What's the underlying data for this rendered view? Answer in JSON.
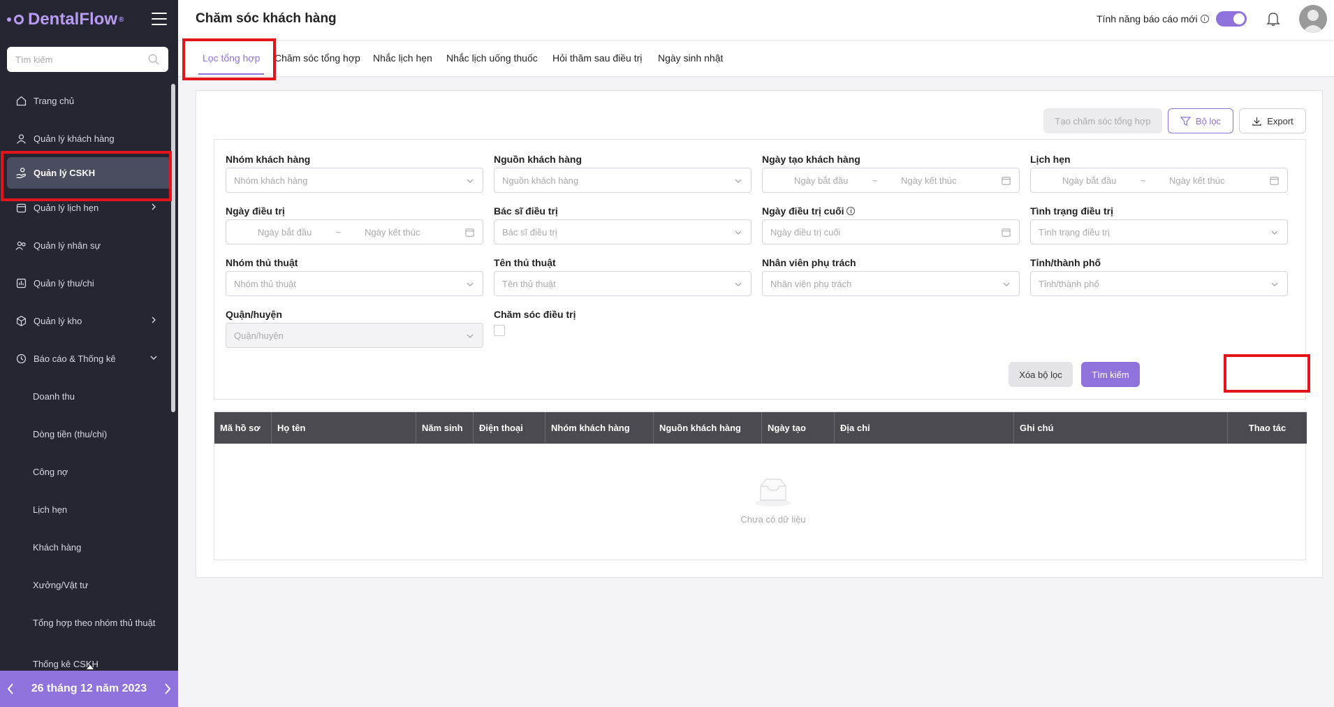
{
  "app": {
    "logo": "DentalFlow",
    "logo_mark": "®"
  },
  "sidebar": {
    "search_placeholder": "Tìm kiếm",
    "items": [
      {
        "label": "Trang chủ",
        "icon": "home-icon"
      },
      {
        "label": "Quản lý khách hàng",
        "icon": "user-icon"
      },
      {
        "label": "Quản lý CSKH",
        "icon": "care-icon",
        "active": true
      },
      {
        "label": "Quản lý lịch hẹn",
        "icon": "calendar-icon"
      },
      {
        "label": "Quản lý nhân sự",
        "icon": "users-icon"
      },
      {
        "label": "Quản lý thu/chi",
        "icon": "finance-icon"
      },
      {
        "label": "Quản lý kho",
        "icon": "box-icon"
      },
      {
        "label": "Báo cáo & Thống kê",
        "icon": "clock-icon"
      }
    ],
    "sub_items": [
      "Doanh thu",
      "Dòng tiền (thu/chi)",
      "Công nợ",
      "Lịch hẹn",
      "Khách hàng",
      "Xưởng/Vật tư",
      "Tổng hợp theo nhóm thủ thuật",
      "Thống kê CSKH"
    ],
    "date": "26 tháng 12 năm 2023"
  },
  "header": {
    "title": "Chăm sóc khách hàng",
    "report_toggle_label": "Tính năng báo cáo mới"
  },
  "tabs": [
    "Lọc tổng hợp",
    "Chăm sóc tổng hợp",
    "Nhắc lịch hẹn",
    "Nhắc lịch uống thuốc",
    "Hỏi thăm sau điều trị",
    "Ngày sinh nhật"
  ],
  "toolbar": {
    "create": "Tạo chăm sóc tổng hợp",
    "filter": "Bộ lọc",
    "export": "Export"
  },
  "filters": {
    "customer_group": {
      "label": "Nhóm khách hàng",
      "placeholder": "Nhóm khách hàng"
    },
    "customer_source": {
      "label": "Nguồn khách hàng",
      "placeholder": "Nguồn khách hàng"
    },
    "created_date": {
      "label": "Ngày tạo khách hàng",
      "start": "Ngày bắt đầu",
      "end": "Ngày kết thúc"
    },
    "appointment": {
      "label": "Lịch hẹn",
      "start": "Ngày bắt đầu",
      "end": "Ngày kết thúc"
    },
    "treatment_date": {
      "label": "Ngày điều trị",
      "start": "Ngày bắt đầu",
      "end": "Ngày kết thúc"
    },
    "doctor": {
      "label": "Bác sĩ điều trị",
      "placeholder": "Bác sĩ điều trị"
    },
    "last_treatment": {
      "label": "Ngày điều trị cuối",
      "placeholder": "Ngày điều trị cuối"
    },
    "treatment_status": {
      "label": "Tình trạng điều trị",
      "placeholder": "Tình trạng điều trị"
    },
    "procedure_group": {
      "label": "Nhóm thủ thuật",
      "placeholder": "Nhóm thủ thuật"
    },
    "procedure_name": {
      "label": "Tên thủ thuật",
      "placeholder": "Tên thủ thuật"
    },
    "staff": {
      "label": "Nhân viên phụ trách",
      "placeholder": "Nhân viên phụ trách"
    },
    "city": {
      "label": "Tỉnh/thành phố",
      "placeholder": "Tỉnh/thành phố"
    },
    "district": {
      "label": "Quận/huyện",
      "placeholder": "Quận/huyện"
    },
    "care_treatment": {
      "label": "Chăm sóc điều trị"
    },
    "range_sep": "~",
    "clear": "Xóa bộ lọc",
    "search": "Tìm kiếm"
  },
  "table": {
    "columns": [
      "Mã hồ sơ",
      "Họ tên",
      "Năm sinh",
      "Điện thoại",
      "Nhóm khách hàng",
      "Nguồn khách hàng",
      "Ngày tạo",
      "Địa chỉ",
      "Ghi chú",
      "Thao tác"
    ],
    "empty_text": "Chưa có dữ liệu"
  },
  "colors": {
    "accent": "#8f72dc",
    "sidebar": "#262633",
    "highlight": "#e3151b"
  }
}
